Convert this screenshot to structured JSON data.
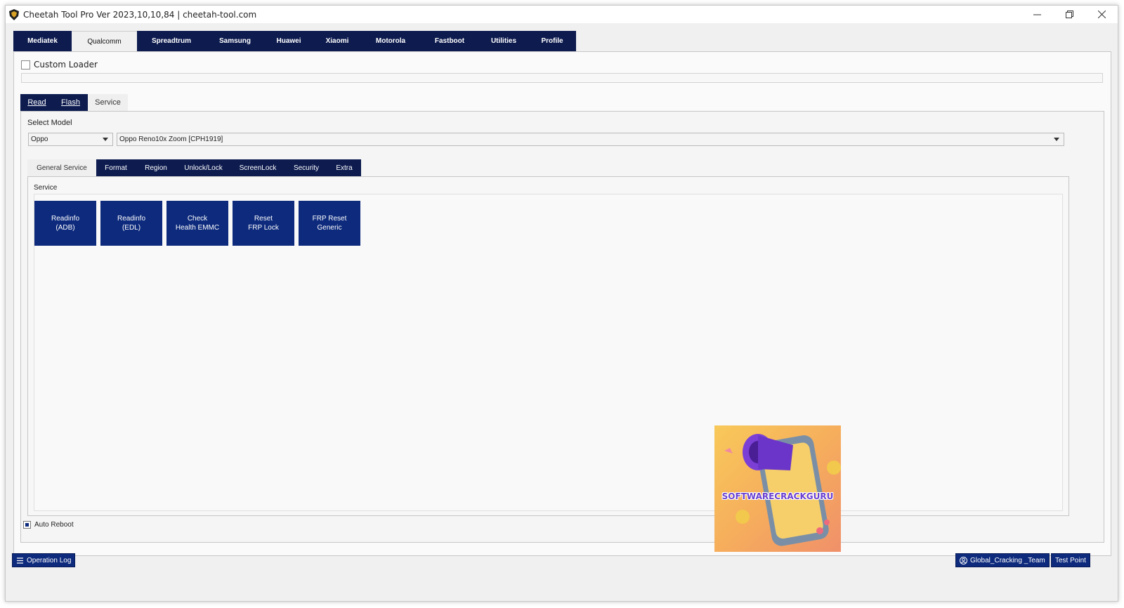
{
  "titlebar": {
    "title": "Cheetah Tool Pro Ver 2023,10,10,84 | cheetah-tool.com"
  },
  "main_tabs": [
    "Mediatek",
    "Qualcomm",
    "Spreadtrum",
    "Samsung",
    "Huawei",
    "Xiaomi",
    "Motorola",
    "Fastboot",
    "Utilities",
    "Profile"
  ],
  "active_main_tab": "Qualcomm",
  "custom_loader": {
    "label": "Custom Loader",
    "checked": false
  },
  "sub_tabs": [
    "Read",
    "Flash",
    "Service"
  ],
  "active_sub_tab": "Service",
  "select_model": {
    "label": "Select Model",
    "brand": "Oppo",
    "model": "Oppo Reno10x Zoom [CPH1919]"
  },
  "func_tabs": [
    "General Service",
    "Format",
    "Region",
    "Unlock/Lock",
    "ScreenLock",
    "Security",
    "Extra"
  ],
  "active_func_tab": "General Service",
  "service": {
    "label": "Service",
    "buttons": [
      "Readinfo\n(ADB)",
      "Readinfo\n(EDL)",
      "Check\nHealth EMMC",
      "Reset\nFRP Lock",
      "FRP Reset\nGeneric"
    ]
  },
  "auto_reboot": {
    "label": "Auto Reboot",
    "checked": true
  },
  "bottom": {
    "operation_log": "Operation Log",
    "team": "Global_Cracking _Team",
    "test_point": "Test Point"
  },
  "promo": {
    "text": "SOFTWARECRACKGURU"
  },
  "colors": {
    "tab_bg": "#0d1b4f",
    "button_bg": "#0d2a7c",
    "promo_text": "#6a3fd1"
  }
}
